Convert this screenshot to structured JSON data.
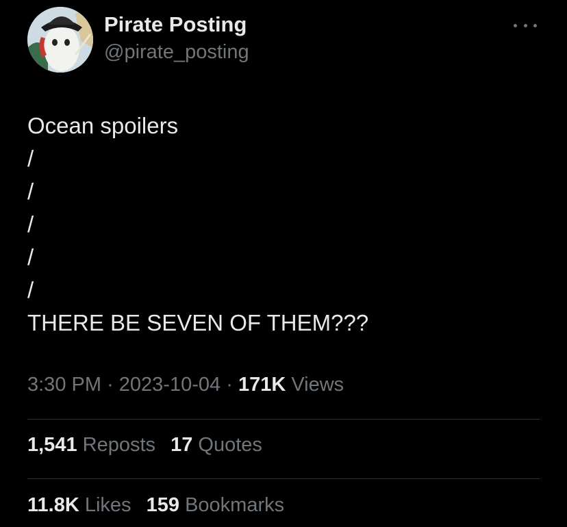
{
  "tweet": {
    "author": {
      "name": "Pirate Posting",
      "handle": "@pirate_posting"
    },
    "lines": [
      "Ocean spoilers",
      "/",
      "/",
      "/",
      "/",
      "/",
      "THERE BE SEVEN OF THEM???"
    ],
    "meta": {
      "time": "3:30 PM",
      "separator": "·",
      "date": "2023-10-04",
      "views_count": "171K",
      "views_label": "Views"
    },
    "stats": {
      "reposts_count": "1,541",
      "reposts_label": "Reposts",
      "quotes_count": "17",
      "quotes_label": "Quotes",
      "likes_count": "11.8K",
      "likes_label": "Likes",
      "bookmarks_count": "159",
      "bookmarks_label": "Bookmarks"
    }
  },
  "icons": {
    "more": "more-horizontal-icon"
  },
  "colors": {
    "background": "#000000",
    "primary_text": "#e7e9ea",
    "secondary_text": "#71767b",
    "divider": "#2f3336"
  }
}
